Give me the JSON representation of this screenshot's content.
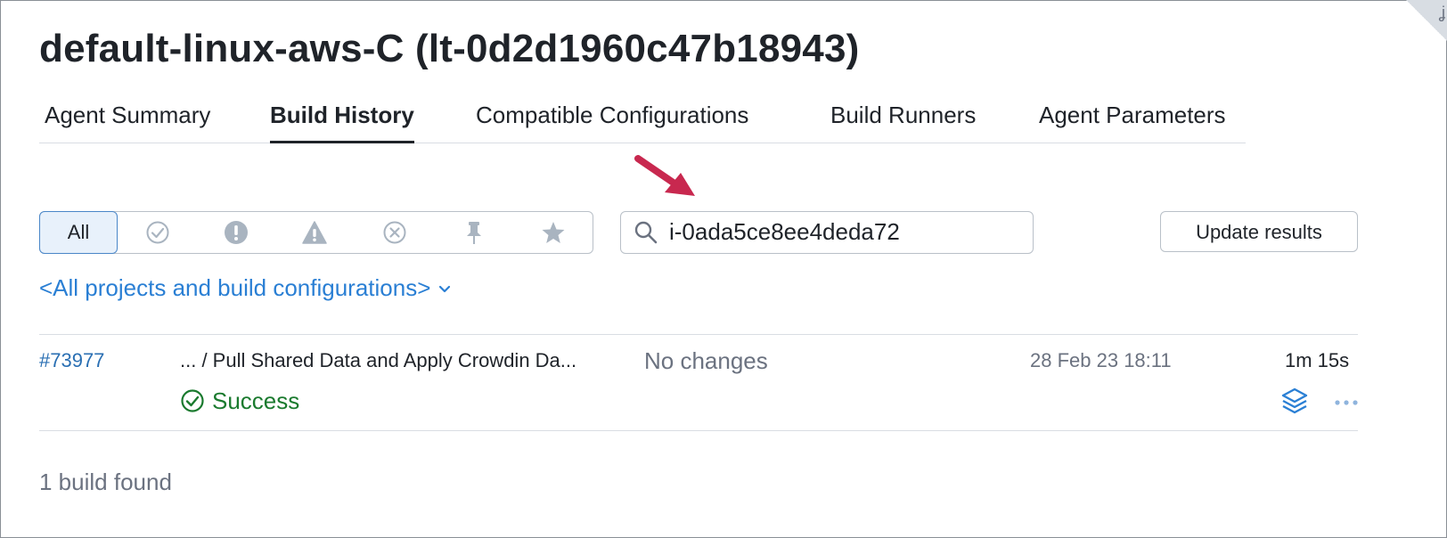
{
  "page": {
    "title": "default-linux-aws-C (lt-0d2d1960c47b18943)",
    "corner_glyph": "ʝ"
  },
  "tabs": [
    {
      "label": "Agent Summary",
      "active": false
    },
    {
      "label": "Build History",
      "active": true
    },
    {
      "label": "Compatible Configurations",
      "active": false
    },
    {
      "label": "Build Runners",
      "active": false
    },
    {
      "label": "Agent Parameters",
      "active": false
    }
  ],
  "filters": {
    "all_label": "All",
    "icons": [
      "success-filter-icon",
      "error-filter-icon",
      "warning-filter-icon",
      "failed-filter-icon",
      "pinned-filter-icon",
      "starred-filter-icon"
    ]
  },
  "search": {
    "value": "i-0ada5ce8ee4deda72",
    "icon": "search-icon"
  },
  "update_button": "Update results",
  "projects_link": "<All projects and build configurations>",
  "builds": [
    {
      "number": "#73977",
      "name": "... / Pull Shared Data and Apply Crowdin Da...",
      "changes": "No changes",
      "date": "28 Feb 23 18:11",
      "duration": "1m 15s",
      "status": "Success"
    }
  ],
  "summary": "1 build found",
  "colors": {
    "link": "#2a7fd4",
    "success": "#1a7a2e",
    "annotation_arrow": "#c8284f",
    "active_filter_bg": "#e8f1fb"
  }
}
